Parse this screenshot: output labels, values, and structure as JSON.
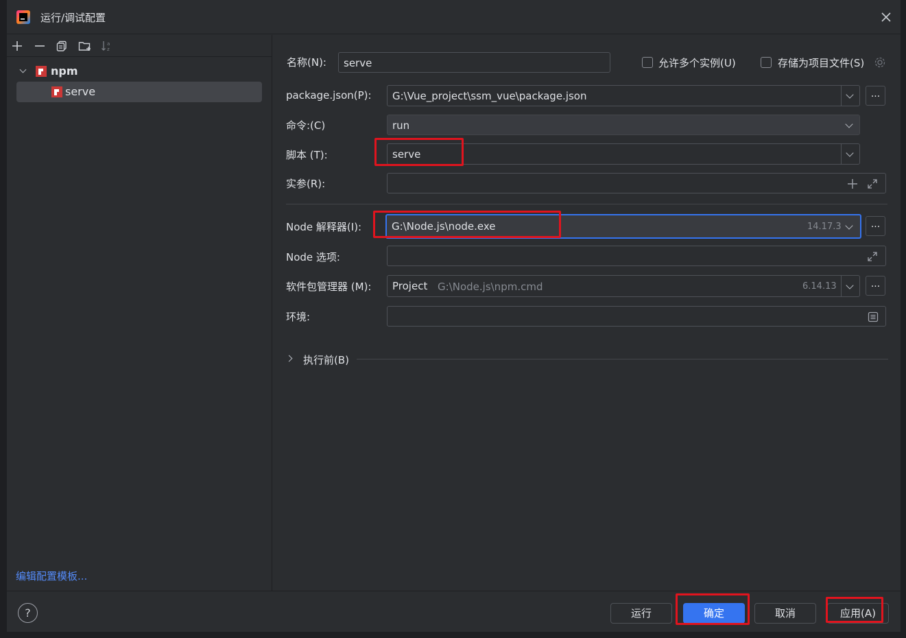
{
  "window": {
    "title": "运行/调试配置"
  },
  "toolbar": {
    "icons": [
      "plus-icon",
      "minus-icon",
      "copy-icon",
      "new-folder-icon",
      "sort-icon"
    ]
  },
  "tree": {
    "group_label": "npm",
    "item_label": "serve"
  },
  "sidebar": {
    "edit_templates_link": "编辑配置模板..."
  },
  "form": {
    "name_label": "名称(N):",
    "name_value": "serve",
    "allow_multiple_label": "允许多个实例(U)",
    "store_as_file_label": "存储为项目文件(S)",
    "package_json_label": "package.json(P):",
    "package_json_value": "G:\\Vue_project\\ssm_vue\\package.json",
    "command_label": "命令:(C)",
    "command_value": "run",
    "scripts_label": "脚本 (T):",
    "scripts_value": "serve",
    "args_label": "实参(R):",
    "args_value": "",
    "node_interpreter_label": "Node 解释器(I):",
    "node_interpreter_value": "G:\\Node.js\\node.exe",
    "node_interpreter_version": "14.17.3",
    "node_options_label": "Node 选项:",
    "node_options_value": "",
    "package_manager_label": "软件包管理器 (M):",
    "package_manager_value": "Project",
    "package_manager_path": "G:\\Node.js\\npm.cmd",
    "package_manager_version": "6.14.13",
    "env_label": "环境:",
    "env_value": "",
    "before_launch_label": "执行前(B)",
    "browse_button": "..."
  },
  "footer": {
    "help_label": "?",
    "run_button": "运行",
    "ok_button": "确定",
    "cancel_button": "取消",
    "apply_button": "应用(A)"
  },
  "colors": {
    "accent": "#3574f0",
    "highlight": "#e0141e",
    "npm_brand": "#cb3837"
  }
}
